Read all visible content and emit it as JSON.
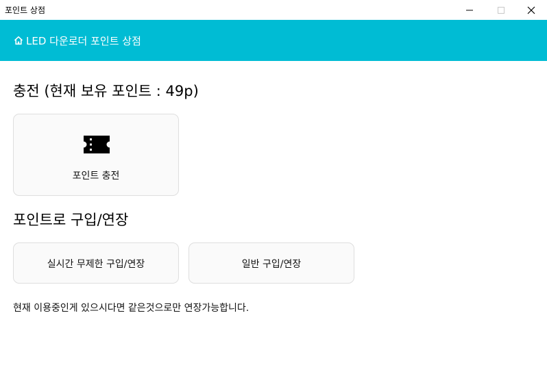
{
  "window": {
    "title": "포인트 상점",
    "icons": [
      "minimize-icon",
      "maximize-icon",
      "close-icon"
    ]
  },
  "header": {
    "icon": "home-icon",
    "title": "LED 다운로더 포인트 상점"
  },
  "charge_section": {
    "heading": "충전 (현재 보유 포인트 : 49p)",
    "card": {
      "icon": "ticket-icon",
      "label": "포인트 충전"
    }
  },
  "purchase_section": {
    "heading": "포인트로 구입/연장",
    "buttons": [
      {
        "label": "실시간 무제한 구입/연장"
      },
      {
        "label": "일반 구입/연장"
      }
    ],
    "note": "현재 이용중인게 있으시다면 같은것으로만 연장가능합니다."
  },
  "colors": {
    "header_bg": "#00bcd4",
    "card_bg": "#fafafa",
    "card_border": "#dedede"
  }
}
